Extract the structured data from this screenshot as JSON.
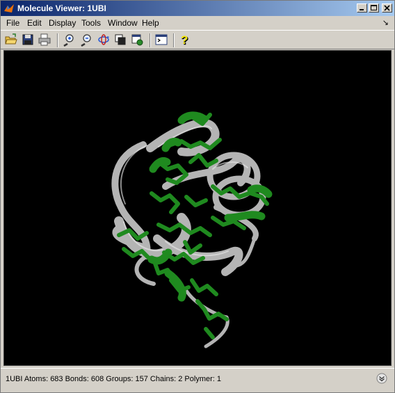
{
  "window": {
    "title": "Molecule Viewer: 1UBI"
  },
  "menu": {
    "items": [
      "File",
      "Edit",
      "Display",
      "Tools",
      "Window",
      "Help"
    ]
  },
  "toolbar": {
    "buttons": [
      "open-icon",
      "save-icon",
      "print-icon",
      "zoom-in-icon",
      "zoom-out-icon",
      "rotate-icon",
      "copy-figure-icon",
      "export-icon",
      "command-window-icon",
      "help-icon"
    ]
  },
  "statusbar": {
    "text": "1UBI    Atoms: 683  Bonds: 608  Groups: 157  Chains: 2  Polymer: 1"
  },
  "colors": {
    "ribbon": "#b4b4b4",
    "sidechain": "#1f8a1f",
    "viewer_background": "#000000"
  }
}
